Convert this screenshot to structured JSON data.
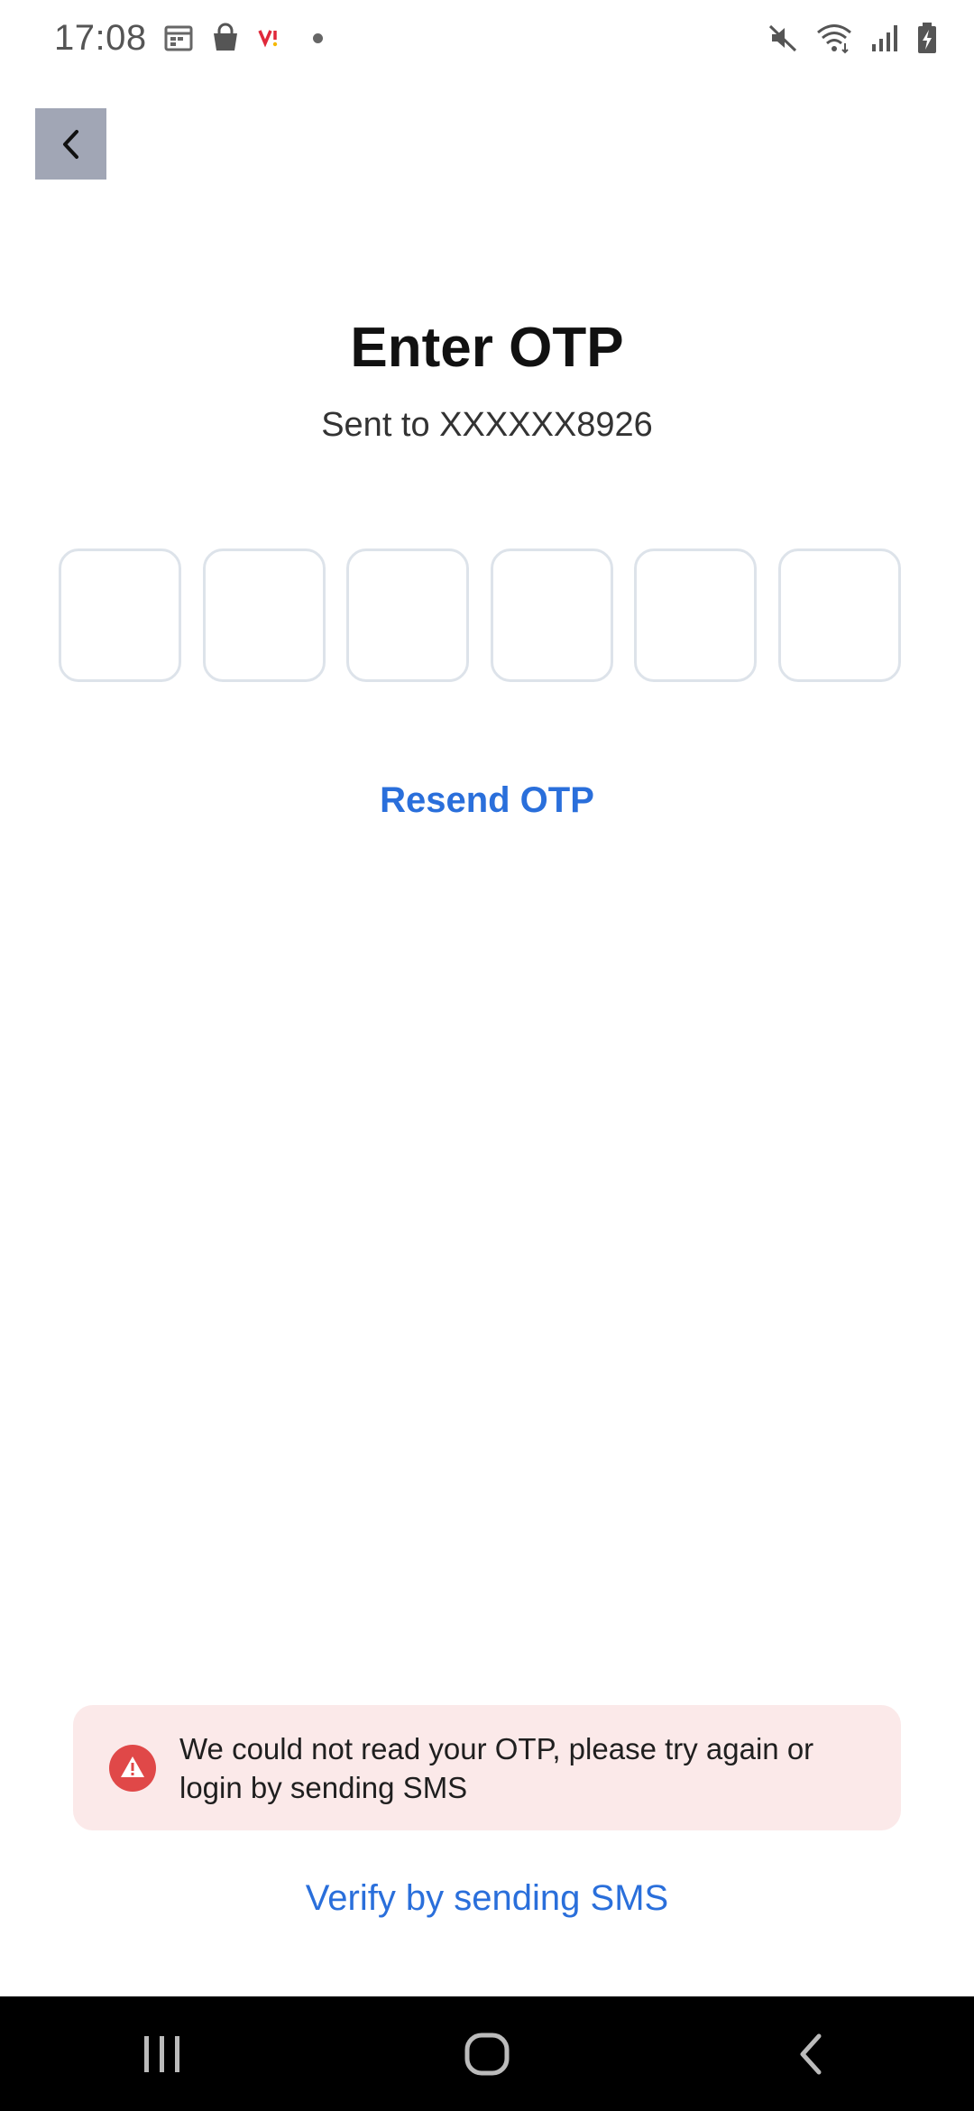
{
  "status_bar": {
    "time": "17:08",
    "left_icons": [
      "calendar-icon",
      "shopping-bag-icon",
      "vi-carrier-icon",
      "dot-icon"
    ],
    "right_icons": [
      "mute-icon",
      "wifi-icon",
      "signal-icon",
      "battery-charging-icon"
    ]
  },
  "header": {
    "back_icon": "chevron-left-icon"
  },
  "main": {
    "title": "Enter OTP",
    "subtitle": "Sent to XXXXXX8926",
    "otp_digits": [
      "",
      "",
      "",
      "",
      "",
      ""
    ],
    "resend_label": "Resend OTP"
  },
  "error": {
    "icon": "warning-icon",
    "message": "We could not read your OTP, please try again or login by sending SMS",
    "color": "#e04848",
    "background": "#fbe9e9"
  },
  "footer": {
    "verify_sms_label": "Verify by sending SMS"
  },
  "nav_bar": {
    "items": [
      "recents-icon",
      "home-icon",
      "back-icon"
    ]
  },
  "colors": {
    "accent": "#2a6fdb",
    "back_button_bg": "#a1a6b5",
    "otp_border": "#dde3ea"
  }
}
